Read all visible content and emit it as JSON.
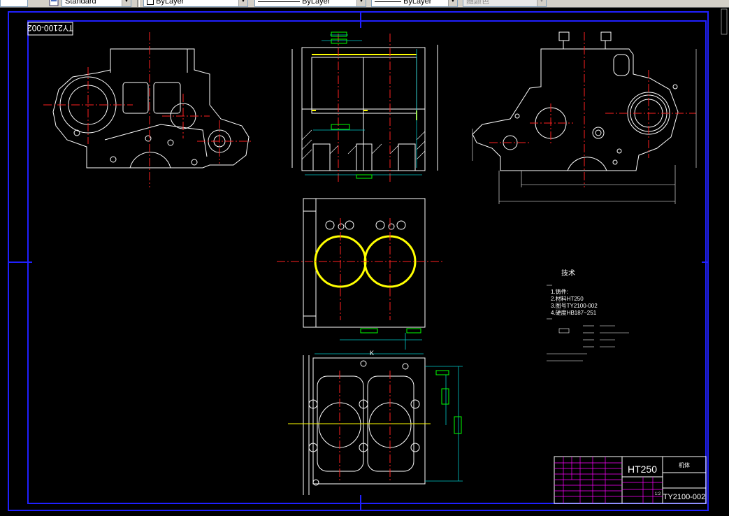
{
  "toolbar": {
    "text_style": "Standard",
    "layer_color": "ByLayer",
    "linetype": "ByLayer",
    "lineweight": "ByLayer",
    "plot_style": "随颜色"
  },
  "drawing": {
    "label_rotated": "TY2100-002",
    "tech_title": "技术",
    "tech_notes": [
      "1.铸件:",
      "2.材料HT250",
      "3.图号TY2100-002",
      "4.硬度HB187~251"
    ],
    "title_block": {
      "material": "HT250",
      "part_name": "机体",
      "drawing_no": "TY2100-002",
      "scale": "1:2"
    },
    "section_label": "K"
  },
  "colors": {
    "frame": "#2020ff",
    "outline": "#ffffff",
    "center": "#ff2020",
    "highlight": "#ffff00",
    "dimension": "#00c8c8",
    "label_box": "#00ff00",
    "title_grid": "#ff00ff"
  }
}
